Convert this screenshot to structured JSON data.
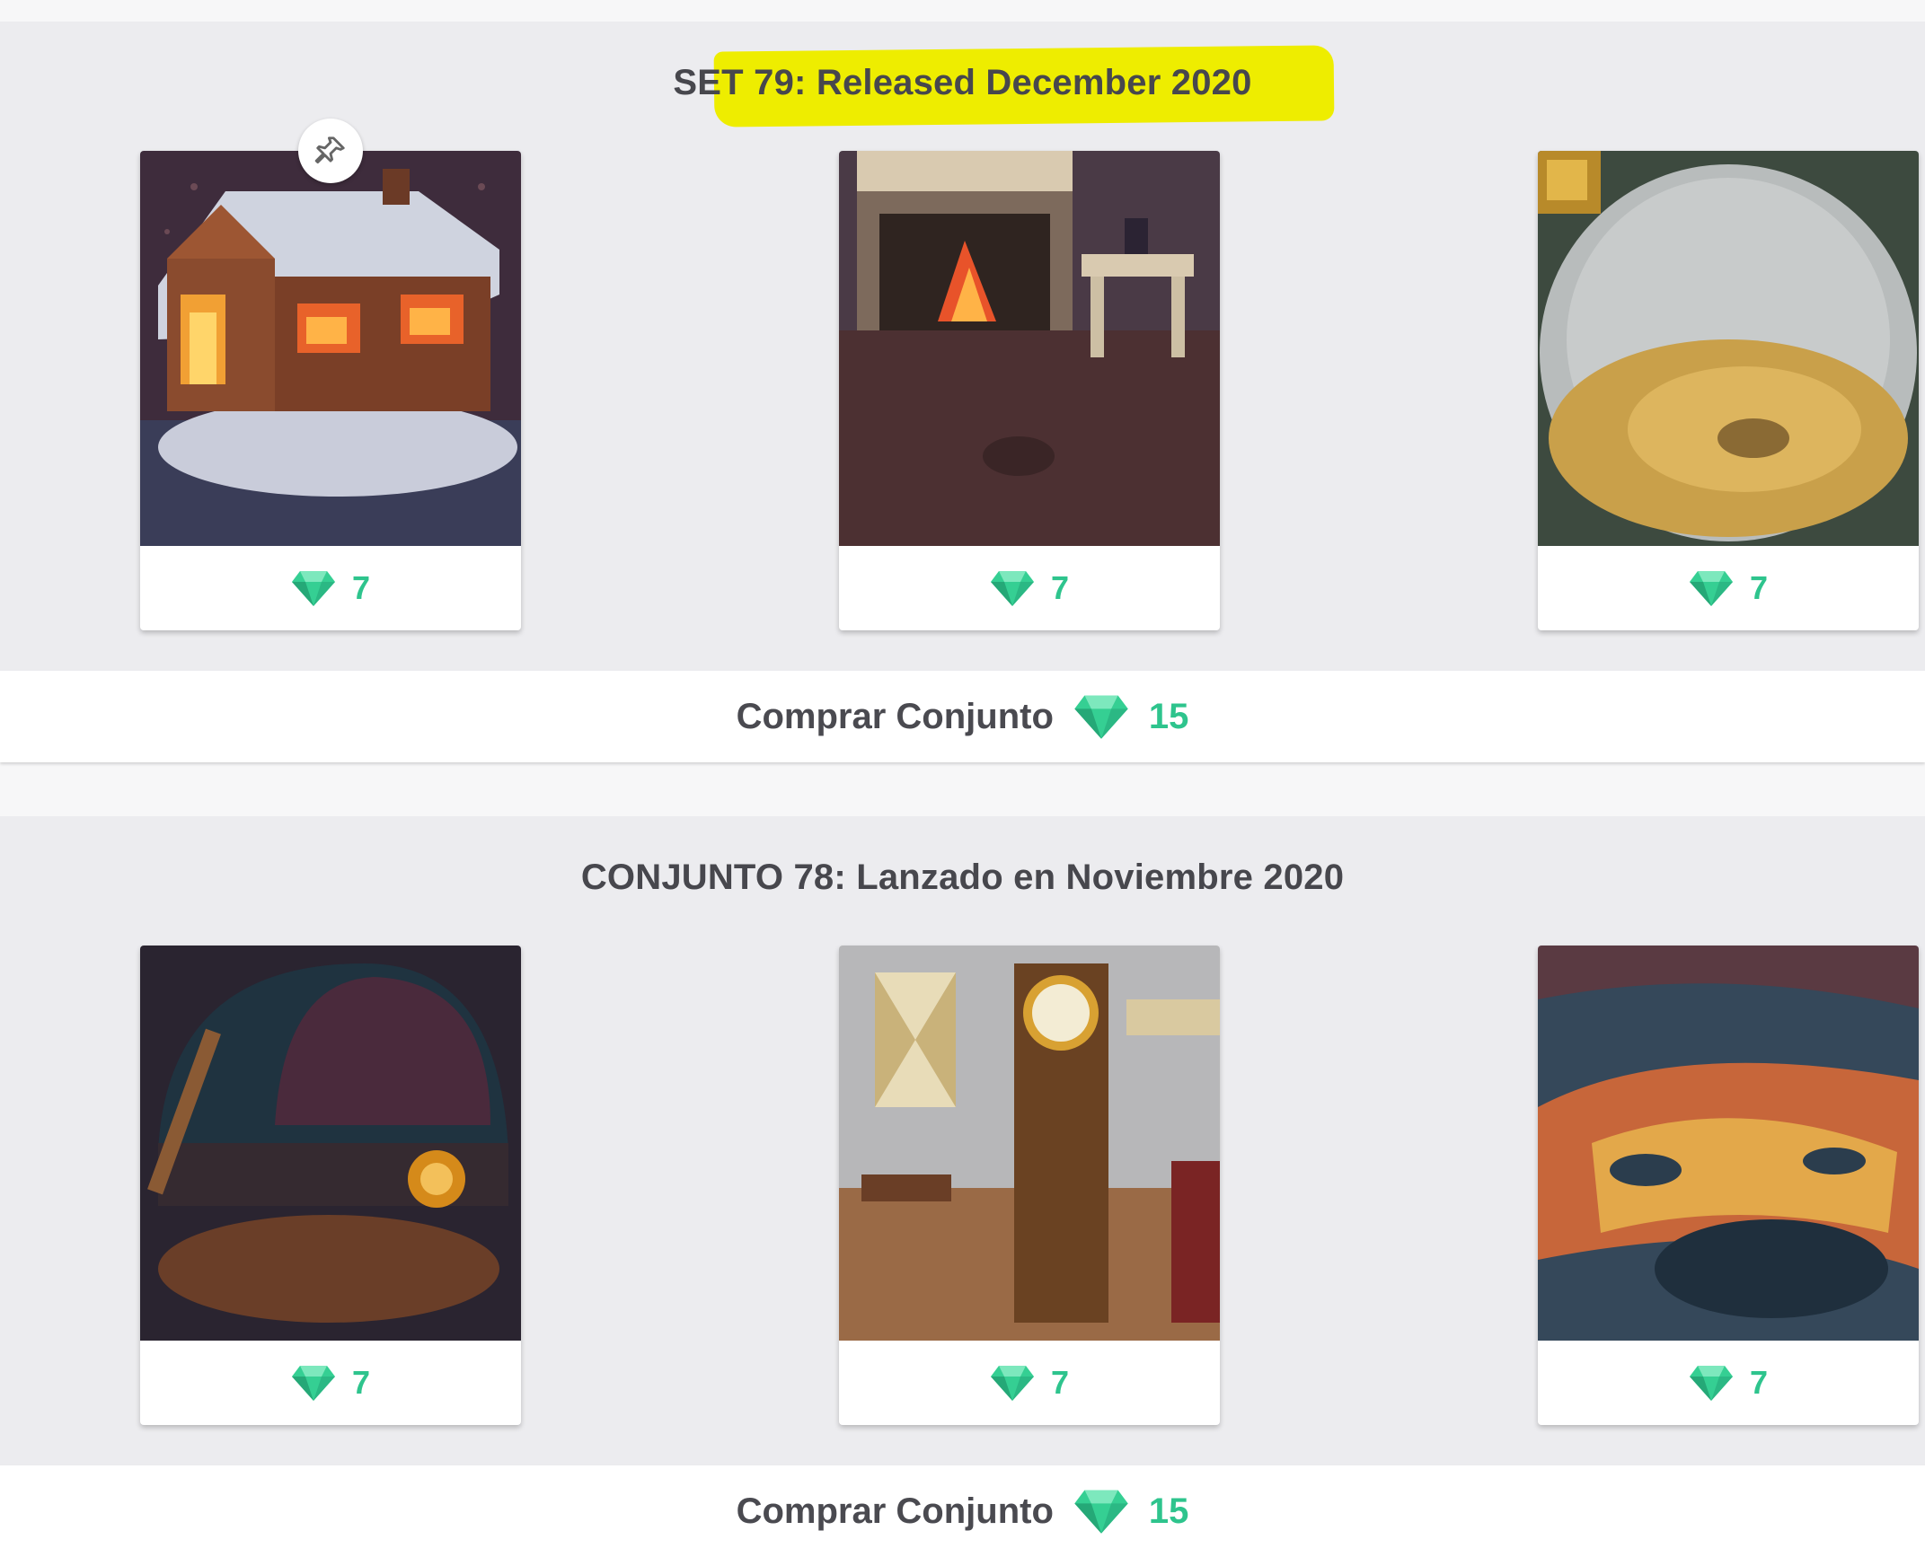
{
  "sets": [
    {
      "title": "SET 79: Released December 2020",
      "highlighted": true,
      "cards": [
        {
          "art": "gingerbread-house-art",
          "price": "7",
          "pinned": true
        },
        {
          "art": "fireplace-room-art",
          "price": "7"
        },
        {
          "art": "gold-sphere-art",
          "price": "7"
        }
      ],
      "buy": {
        "label": "Comprar Conjunto",
        "price": "15"
      }
    },
    {
      "title": "CONJUNTO 78: Lanzado en Noviembre 2020",
      "cards": [
        {
          "art": "observatory-room-art",
          "price": "7"
        },
        {
          "art": "clock-room-art",
          "price": "7"
        },
        {
          "art": "lava-pit-art",
          "price": "7"
        }
      ],
      "buy": {
        "label": "Comprar Conjunto",
        "price": "15"
      }
    }
  ],
  "colors": {
    "accent_green": "#2ec48d",
    "highlight_yellow": "#eeed00",
    "section_bg": "#ececef",
    "text_dark": "#4a4a50"
  },
  "icons": {
    "price": "gem-icon",
    "pin": "pin-icon"
  }
}
